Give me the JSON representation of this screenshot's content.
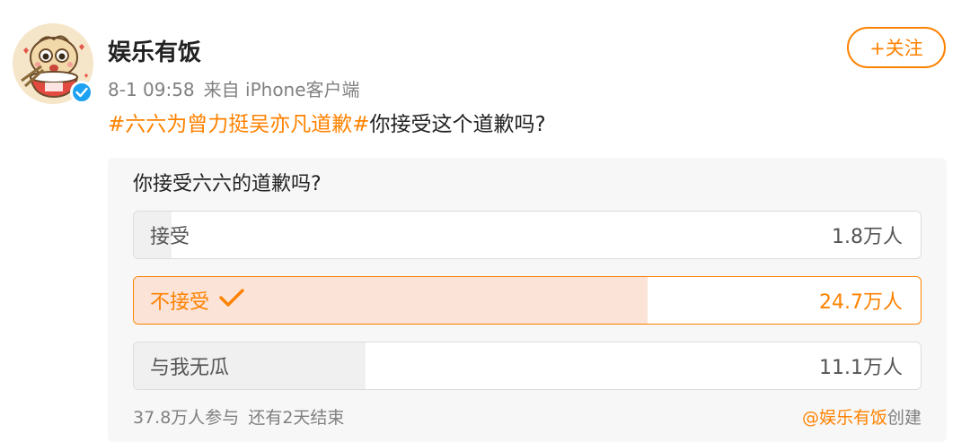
{
  "post": {
    "author": {
      "name": "娱乐有饭",
      "avatar_icon": "cartoon-dumpling-eating-rice-avatar",
      "verified_icon": "verified-check-icon"
    },
    "date": "8-1 09:58",
    "source": "来自 iPhone客户端",
    "follow_label": "+关注",
    "hashtag": "#六六为曾力挺吴亦凡道歉#",
    "text": "你接受这个道歉吗?"
  },
  "poll": {
    "question": "你接受六六的道歉吗?",
    "options": [
      {
        "label": "接受",
        "count": "1.8万人",
        "share": 0.048,
        "selected": false
      },
      {
        "label": "不接受",
        "count": "24.7万人",
        "share": 0.653,
        "selected": true
      },
      {
        "label": "与我无瓜",
        "count": "11.1万人",
        "share": 0.294,
        "selected": false
      }
    ],
    "participants": "37.8万人参与",
    "remaining": "还有2天结束",
    "creator": "@娱乐有饭",
    "created_suffix": "创建"
  },
  "colors": {
    "accent": "#ff8200",
    "selected_fill": "#fbe3d7",
    "option_fill": "#f0f0f0",
    "verified_blue": "#1da1f2"
  }
}
